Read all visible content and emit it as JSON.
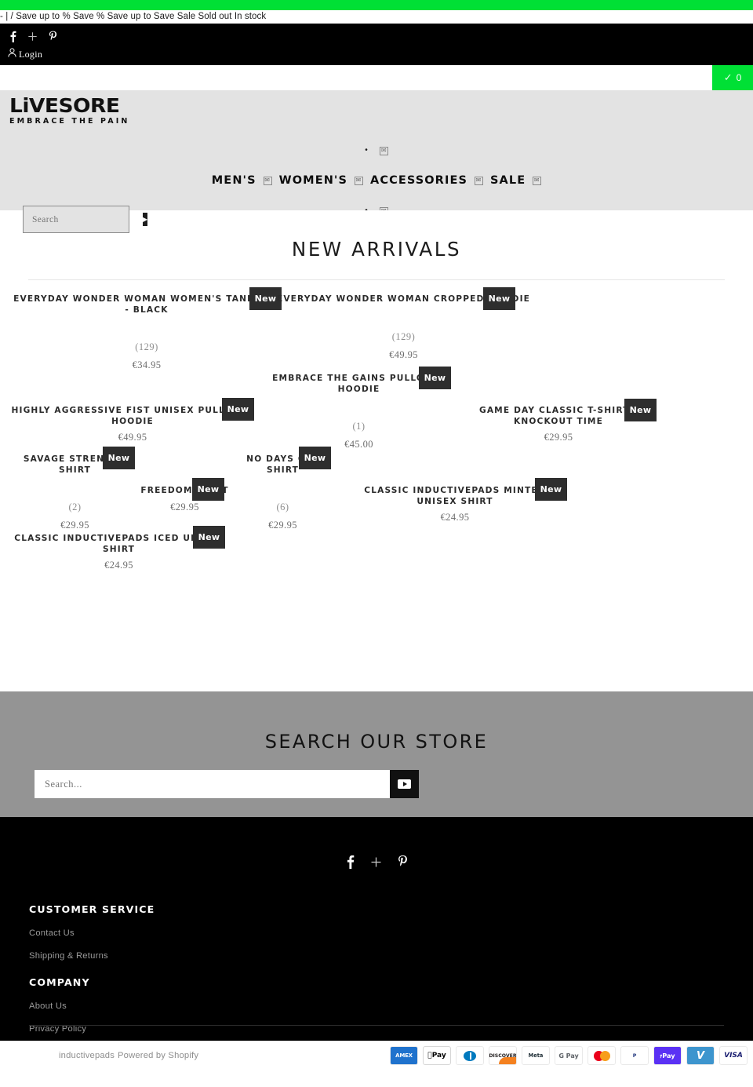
{
  "announcement": {
    "text": "- | / Save up to % Save % Save up to Save Sale Sold out In stock"
  },
  "utility": {
    "social": [
      {
        "name": "facebook",
        "glyph": "f"
      },
      {
        "name": "twitter",
        "glyph": "+"
      },
      {
        "name": "pinterest",
        "glyph": "P"
      }
    ],
    "login_label": "Login"
  },
  "cart": {
    "count": "0",
    "icon": "check-icon"
  },
  "brand": {
    "name": "LiVESORE",
    "tagline": "EMBRACE THE PAIN"
  },
  "nav": {
    "items": [
      {
        "label": "MEN'S"
      },
      {
        "label": "WOMEN'S"
      },
      {
        "label": "ACCESSORIES"
      },
      {
        "label": "SALE"
      }
    ],
    "broken_icon": "✉"
  },
  "header_search": {
    "placeholder": "Search"
  },
  "main": {
    "title": "NEW ARRIVALS",
    "badge_label": "New",
    "products": [
      {
        "name": "EVERYDAY WONDER WOMAN WOMEN'S TANK TOP - BLACK",
        "reviews": "(129)",
        "price": "€34.95"
      },
      {
        "name": "EVERYDAY WONDER WOMAN CROPPED HOODIE",
        "reviews": "(129)",
        "price": "€49.95"
      },
      {
        "name": "EMBRACE THE GAINS PULLOVER HOODIE",
        "reviews": "(1)",
        "price": "€45.00"
      },
      {
        "name": "HIGHLY AGGRESSIVE FIST UNISEX PULLOVER HOODIE",
        "reviews": "",
        "price": "€49.95"
      },
      {
        "name": "GAME DAY CLASSIC T-SHIRT - KNOCKOUT TIME",
        "reviews": "",
        "price": "€29.95"
      },
      {
        "name": "SAVAGE STRENGTH SHIRT",
        "reviews": "(2)",
        "price": "€29.95"
      },
      {
        "name": "FREEDOM SHIRT",
        "reviews": "",
        "price": "€29.95"
      },
      {
        "name": "NO DAYS OFF SHIRT",
        "reviews": "(6)",
        "price": "€29.95"
      },
      {
        "name": "CLASSIC INDUCTIVEPADS MINTED UNISEX SHIRT",
        "reviews": "",
        "price": "€24.95"
      },
      {
        "name": "CLASSIC INDUCTIVEPADS ICED UNISEX SHIRT",
        "reviews": "",
        "price": "€24.95"
      }
    ]
  },
  "store_search": {
    "title": "SEARCH OUR STORE",
    "placeholder": "Search..."
  },
  "footer": {
    "social": [
      {
        "name": "facebook",
        "glyph": "f"
      },
      {
        "name": "twitter",
        "glyph": "+"
      },
      {
        "name": "pinterest",
        "glyph": "P"
      }
    ],
    "groups": [
      {
        "heading": "CUSTOMER SERVICE",
        "links": [
          "Contact Us",
          "Shipping & Returns"
        ]
      },
      {
        "heading": "COMPANY",
        "links": [
          "About Us",
          "Privacy Policy"
        ]
      }
    ]
  },
  "bottom": {
    "shop_name": "inductivepads",
    "powered_by": "Powered by Shopify",
    "payments": [
      {
        "key": "amex",
        "label": "AMEX"
      },
      {
        "key": "apay",
        "label": "Pay"
      },
      {
        "key": "diners",
        "label": ""
      },
      {
        "key": "discover",
        "label": "DISCOVER"
      },
      {
        "key": "meta",
        "label": "Meta"
      },
      {
        "key": "gpay",
        "label": "G Pay"
      },
      {
        "key": "mc",
        "label": ""
      },
      {
        "key": "paypal",
        "label": "P"
      },
      {
        "key": "shoppay",
        "label": "Pay"
      },
      {
        "key": "venmo",
        "label": "V"
      },
      {
        "key": "visa",
        "label": "VISA"
      }
    ]
  },
  "colors": {
    "accent_green": "#00e035",
    "badge_dark": "#2e2e2e",
    "header_gray": "#e3e3e3"
  }
}
